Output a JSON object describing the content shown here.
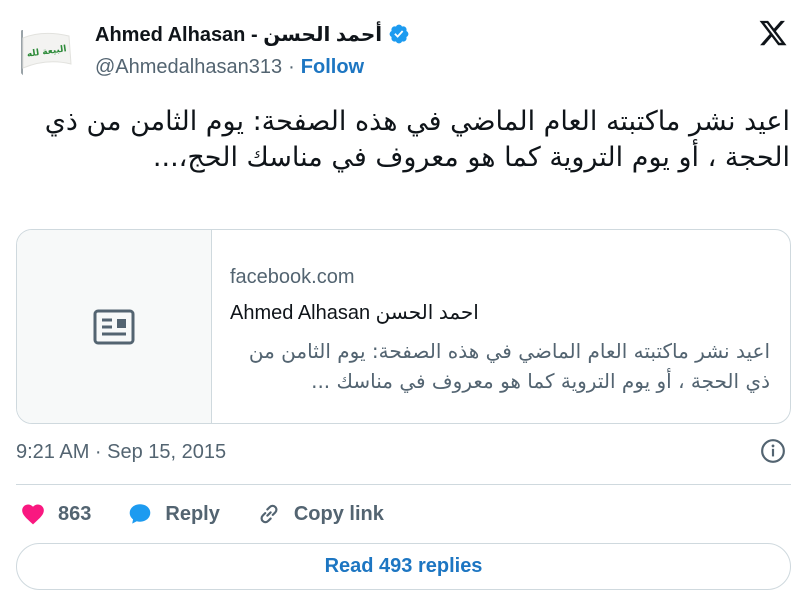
{
  "author": {
    "display_name": "Ahmed Alhasan - أحمد الحسن",
    "handle": "@Ahmedalhasan313",
    "separator": "·",
    "follow_label": "Follow",
    "avatar_flag_text": "البيعة لله"
  },
  "tweet": {
    "text": "اعيد نشر ماكتبته العام الماضي في هذه الصفحة: يوم الثامن من ذي الحجة ، أو يوم التروية كما هو معروف في مناسك الحج،..."
  },
  "link_card": {
    "domain": "facebook.com",
    "title": "Ahmed Alhasan احمد الحسن",
    "description": "اعيد نشر ماكتبته العام الماضي في هذه الصفحة: يوم الثامن من ذي الحجة ، أو يوم التروية كما هو معروف في مناسك ..."
  },
  "timestamp": "9:21 AM · Sep 15, 2015",
  "actions": {
    "like_count": "863",
    "reply_label": "Reply",
    "copy_link_label": "Copy link"
  },
  "replies_button_label": "Read 493 replies",
  "colors": {
    "link_blue": "#1d76c2",
    "like_pink": "#f91880",
    "reply_blue": "#1d9bf0",
    "muted_text": "#536471",
    "border": "#cfd9de",
    "flag_green": "#2e8b3a"
  },
  "icons": [
    "verified-badge-icon",
    "x-logo-icon",
    "article-icon",
    "info-icon",
    "heart-icon",
    "reply-bubble-icon",
    "link-icon"
  ]
}
